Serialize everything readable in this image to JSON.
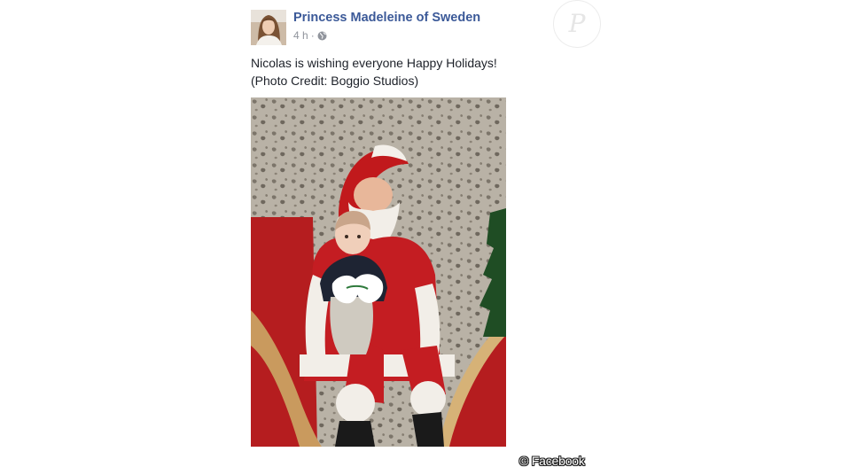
{
  "post": {
    "page_name": "Princess Madeleine of Sweden",
    "timestamp": "4 h",
    "separator": "·",
    "audience_icon": "globe-icon",
    "text_line1": "Nicolas is wishing everyone Happy Holidays!",
    "text_line2": "(Photo Credit: Boggio Studios)"
  },
  "watermark": {
    "letter": "P"
  },
  "credit": {
    "text": "© Facebook"
  },
  "colors": {
    "link": "#3b5998",
    "meta": "#90949c",
    "body_text": "#1d2129"
  }
}
